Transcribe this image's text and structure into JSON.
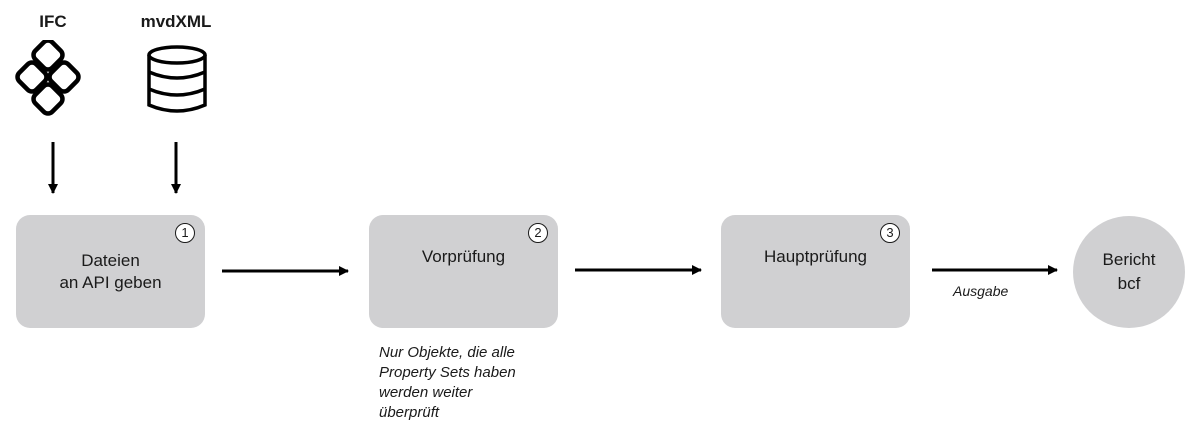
{
  "inputs": {
    "ifc_label": "IFC",
    "ifc_icon": "ifc-logo-icon",
    "mvdxml_label": "mvdXML",
    "mvdxml_icon": "database-icon"
  },
  "steps": [
    {
      "number": "1",
      "lines": [
        "Dateien",
        "an API geben"
      ]
    },
    {
      "number": "2",
      "lines": [
        "Vorprüfung"
      ]
    },
    {
      "number": "3",
      "lines": [
        "Hauptprüfung"
      ]
    }
  ],
  "output": {
    "lines": [
      "Bericht",
      "bcf"
    ],
    "edge_label": "Ausgabe"
  },
  "note": {
    "lines": [
      "Nur Objekte, die alle",
      "Property Sets haben",
      "werden weiter",
      "überprüft"
    ]
  },
  "colors": {
    "node_fill": "#d0d0d2",
    "text": "#1a1a1a",
    "arrow": "#000000"
  }
}
